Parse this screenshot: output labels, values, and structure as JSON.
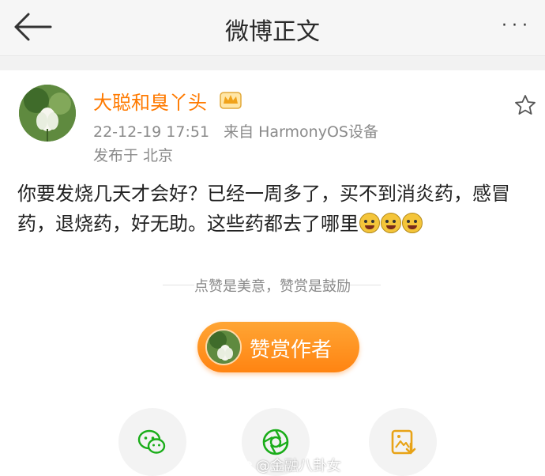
{
  "header": {
    "title": "微博正文",
    "more_label": "···"
  },
  "post": {
    "author": "大聪和臭丫头",
    "timestamp": "22-12-19 17:51",
    "source": "来自 HarmonyOS设备",
    "location": "发布于 北京",
    "text": "你要发烧几天才会好？已经一周多了，买不到消炎药，感冒药，退烧药，好无助。这些药都去了哪里"
  },
  "reward": {
    "hint": "点赞是美意，赞赏是鼓励",
    "button_label": "赞赏作者"
  },
  "watermark": {
    "text": "@金融八卦女"
  },
  "colors": {
    "accent": "#ff7a00",
    "reward_button": "#ff9423",
    "wechat": "#1aad19",
    "moments": "#1aad19",
    "save_image": "#e8a317"
  },
  "icons": {
    "back": "back-arrow-icon",
    "crown": "vip-crown-icon",
    "star": "star-icon",
    "emoji": "crying-face-emoji",
    "share_wechat": "wechat-icon",
    "share_moments": "moments-icon",
    "share_image": "save-image-icon"
  }
}
